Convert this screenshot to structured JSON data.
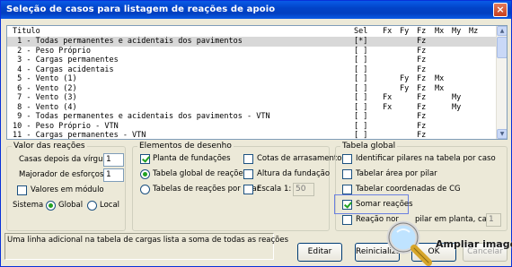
{
  "window": {
    "title": "Seleção de casos para listagem de reações de apoio",
    "close_label": "×"
  },
  "list": {
    "columns": [
      "Titulo",
      "Sel",
      "Fx",
      "Fy",
      "Fz",
      "Mx",
      "My",
      "Mz"
    ],
    "rows": [
      {
        "titulo": " 1 - Todas permanentes e acidentais dos pavimentos",
        "sel": "[*]",
        "fx": "",
        "fy": "",
        "fz": "Fz",
        "mx": "",
        "my": "",
        "mz": "",
        "selected": true
      },
      {
        "titulo": " 2 - Peso Próprio",
        "sel": "[ ]",
        "fx": "",
        "fy": "",
        "fz": "Fz",
        "mx": "",
        "my": "",
        "mz": ""
      },
      {
        "titulo": " 3 - Cargas permanentes",
        "sel": "[ ]",
        "fx": "",
        "fy": "",
        "fz": "Fz",
        "mx": "",
        "my": "",
        "mz": ""
      },
      {
        "titulo": " 4 - Cargas acidentais",
        "sel": "[ ]",
        "fx": "",
        "fy": "",
        "fz": "Fz",
        "mx": "",
        "my": "",
        "mz": ""
      },
      {
        "titulo": " 5 - Vento (1)",
        "sel": "[ ]",
        "fx": "",
        "fy": "Fy",
        "fz": "Fz",
        "mx": "Mx",
        "my": "",
        "mz": ""
      },
      {
        "titulo": " 6 - Vento (2)",
        "sel": "[ ]",
        "fx": "",
        "fy": "Fy",
        "fz": "Fz",
        "mx": "Mx",
        "my": "",
        "mz": ""
      },
      {
        "titulo": " 7 - Vento (3)",
        "sel": "[ ]",
        "fx": "Fx",
        "fy": "",
        "fz": "Fz",
        "mx": "",
        "my": "My",
        "mz": ""
      },
      {
        "titulo": " 8 - Vento (4)",
        "sel": "[ ]",
        "fx": "Fx",
        "fy": "",
        "fz": "Fz",
        "mx": "",
        "my": "My",
        "mz": ""
      },
      {
        "titulo": " 9 - Todas permanentes e acidentais dos pavimentos - VTN",
        "sel": "[ ]",
        "fx": "",
        "fy": "",
        "fz": "Fz",
        "mx": "",
        "my": "",
        "mz": ""
      },
      {
        "titulo": "10 - Peso Próprio - VTN",
        "sel": "[ ]",
        "fx": "",
        "fy": "",
        "fz": "Fz",
        "mx": "",
        "my": "",
        "mz": ""
      },
      {
        "titulo": "11 - Cargas permanentes - VTN",
        "sel": "[ ]",
        "fx": "",
        "fy": "",
        "fz": "Fz",
        "mx": "",
        "my": "",
        "mz": ""
      }
    ]
  },
  "valor": {
    "legend": "Valor das reações",
    "casas_label": "Casas depois da vírgula",
    "casas_value": "1",
    "majorador_label": "Majorador de esforços",
    "majorador_value": "1",
    "modulo_label": "Valores em módulo",
    "sistema_label": "Sistema",
    "global_label": "Global",
    "local_label": "Local"
  },
  "desenho": {
    "legend": "Elementos de desenho",
    "planta_label": "Planta de fundações",
    "cotas_label": "Cotas de arrasamento",
    "tabela_global_label": "Tabela global de reações",
    "altura_label": "Altura da fundação",
    "tabelas_pilar_label": "Tabelas de reações por pilar",
    "escala_label": "Escala 1:",
    "escala_value": "50"
  },
  "tabela": {
    "legend": "Tabela global",
    "identificar_label": "Identificar pilares na tabela por caso",
    "area_label": "Tabelar área por pilar",
    "coordenadas_label": "Tabelar coordenadas de CG",
    "somar_label": "Somar reações",
    "reacao_label": "Reação nor",
    "reacao_tail": "pilar em planta, caso",
    "reacao_value": "1"
  },
  "status_text": "Uma linha adicional na tabela de cargas lista a soma de todas as reações",
  "buttons": {
    "editar": "Editar",
    "reinicializar": "Reinicializar",
    "ok": "OK",
    "cancelar": "Cancelar"
  },
  "overlay": {
    "magnifier_label": "Ampliar imagem"
  }
}
